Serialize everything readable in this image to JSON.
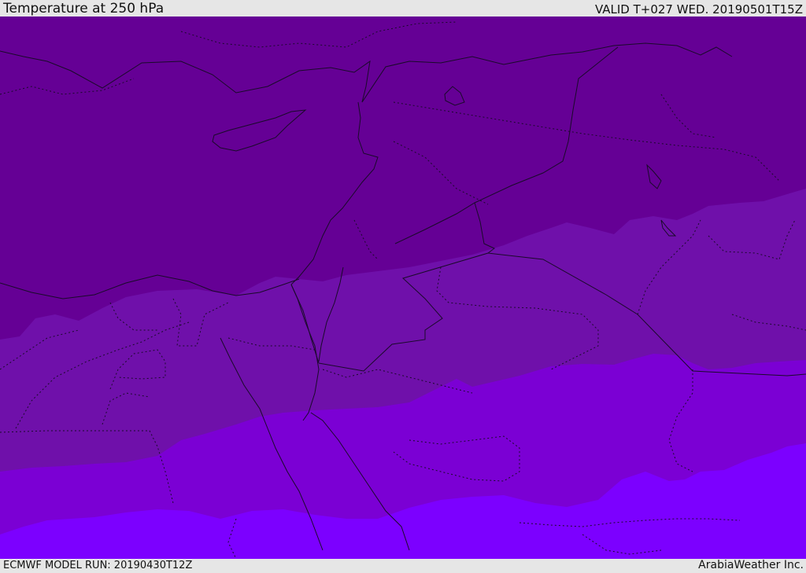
{
  "header": {
    "title": "Temperature at 250 hPa",
    "valid": "VALID T+027 WED. 20190501T15Z"
  },
  "footer": {
    "run": "ECMWF MODEL RUN: 20190430T12Z",
    "brand": "ArabiaWeather Inc."
  },
  "map": {
    "parameter": "Temperature at 250 hPa",
    "bands": [
      {
        "name": "coldest",
        "color": "#650095"
      },
      {
        "name": "band-2",
        "color": "#6f10aa"
      },
      {
        "name": "band-3",
        "color": "#7b00d4"
      },
      {
        "name": "warmest",
        "color": "#7c00ff"
      }
    ],
    "border_color": "#1a0a2a"
  }
}
